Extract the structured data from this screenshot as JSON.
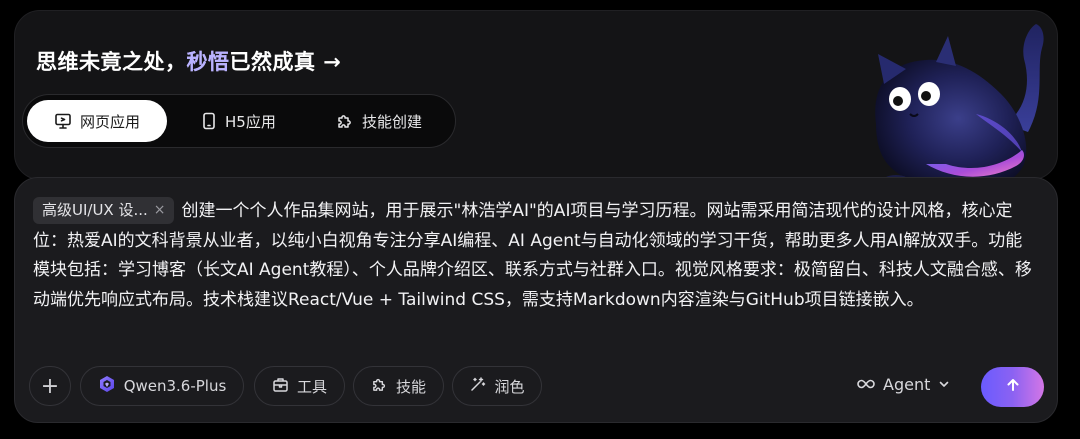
{
  "hero": {
    "headline_prefix": "思维未竟之处，",
    "headline_accent": "秒悟",
    "headline_suffix": "已然成真 →"
  },
  "tabs": [
    {
      "label": "网页应用",
      "icon": "monitor-icon",
      "active": true
    },
    {
      "label": "H5应用",
      "icon": "phone-icon",
      "active": false
    },
    {
      "label": "技能创建",
      "icon": "puzzle-icon",
      "active": false
    }
  ],
  "input": {
    "chip_label": "高级UI/UX 设...",
    "chip_close": "×",
    "prompt_text": "创建一个个人作品集网站，用于展示\"林浩学AI\"的AI项目与学习历程。网站需采用简洁现代的设计风格，核心定位：热爱AI的文科背景从业者，以纯小白视角专注分享AI编程、AI Agent与自动化领域的学习干货，帮助更多人用AI解放双手。功能模块包括：学习博客（长文AI Agent教程）、个人品牌介绍区、联系方式与社群入口。视觉风格要求：极简留白、科技人文融合感、移动端优先响应式布局。技术栈建议React/Vue + Tailwind CSS，需支持Markdown内容渲染与GitHub项目链接嵌入。"
  },
  "toolbar": {
    "add_label": "+",
    "model_label": "Qwen3.6-Plus",
    "tools_label": "工具",
    "skills_label": "技能",
    "polish_label": "润色",
    "agent_label": "Agent",
    "agent_icon": "infinity-icon"
  },
  "colors": {
    "accent_gradient_start": "#6a5bff",
    "accent_gradient_end": "#d376e6",
    "headline_accent": "#b9b2ff"
  }
}
